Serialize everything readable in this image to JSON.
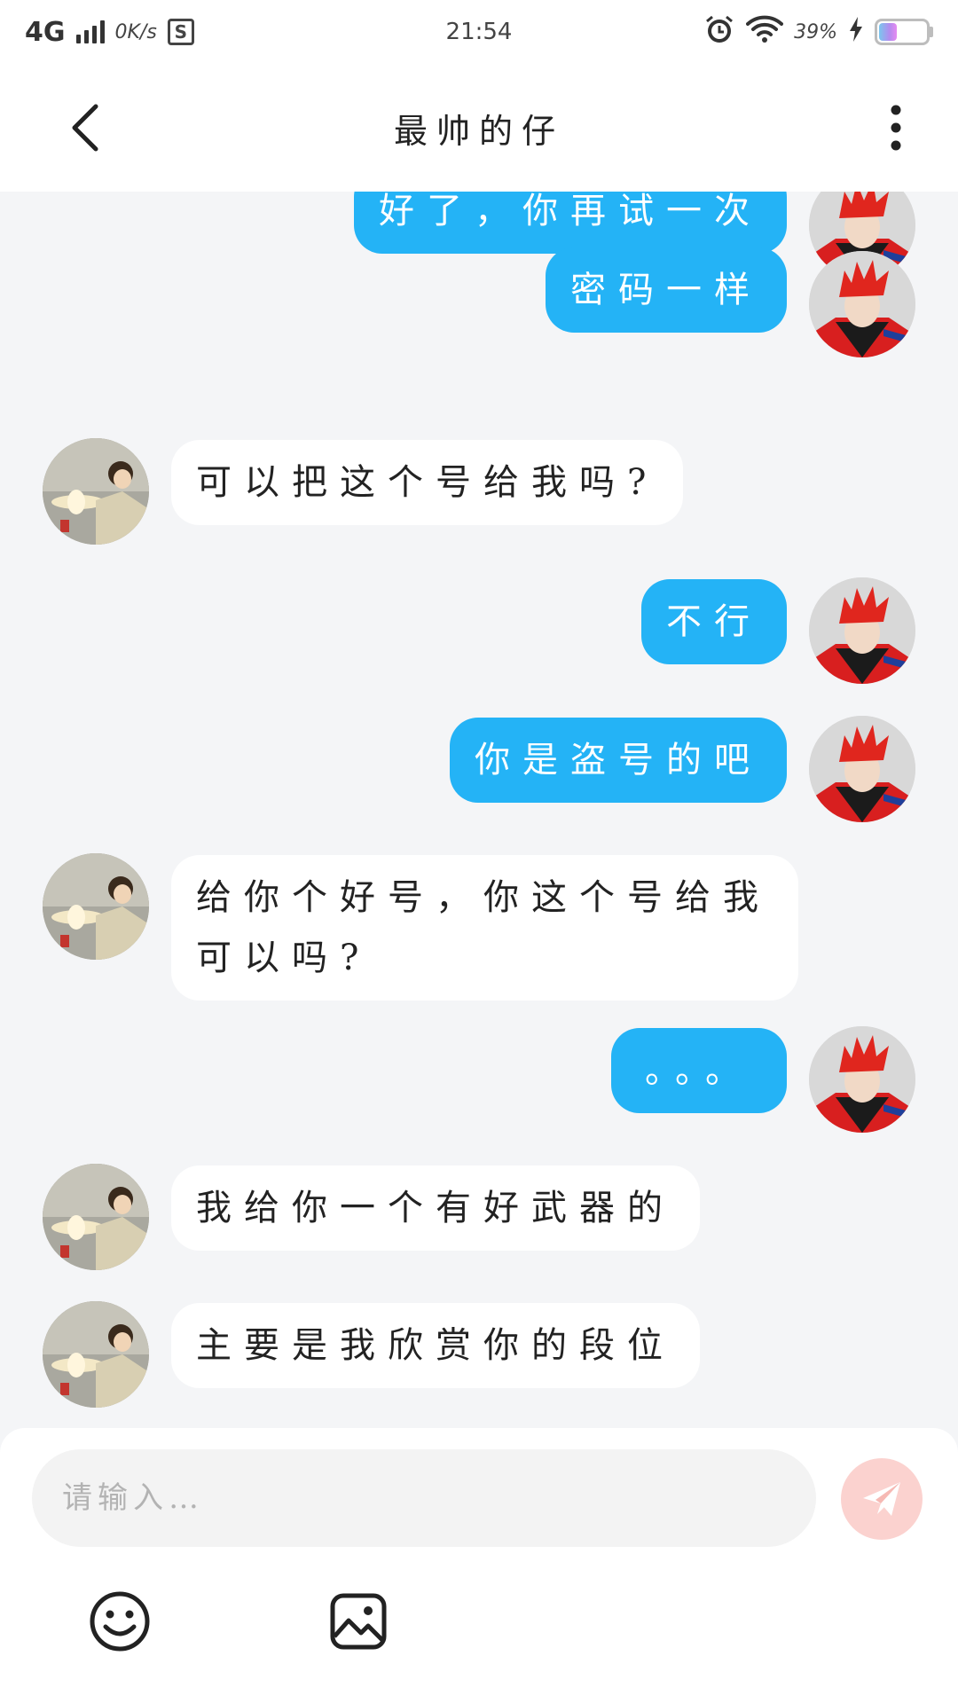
{
  "status_bar": {
    "network": "4G",
    "speed": "0K/s",
    "s_badge": "S",
    "time": "21:54",
    "battery": "39%",
    "battery_level": 0.39
  },
  "header": {
    "title": "最帅的仔",
    "back_icon": "chevron-left-icon",
    "more_icon": "more-vertical-icon"
  },
  "messages": [
    {
      "side": "self",
      "text": "好了，你再试一次"
    },
    {
      "side": "self",
      "text": "密码一样"
    },
    {
      "side": "other",
      "text": "可以把这个号给我吗?"
    },
    {
      "side": "self",
      "text": "不行"
    },
    {
      "side": "self",
      "text": "你是盗号的吧"
    },
    {
      "side": "other",
      "text": "给你个好号，你这个号给我可以吗?"
    },
    {
      "side": "self",
      "text": "。。。"
    },
    {
      "side": "other",
      "text": "我给你一个有好武器的"
    },
    {
      "side": "other",
      "text": "主要是我欣赏你的段位"
    }
  ],
  "input": {
    "placeholder": "请输入…",
    "value": ""
  },
  "icons": {
    "send": "send-icon",
    "emoji": "emoji-icon",
    "image": "image-icon"
  },
  "colors": {
    "self_bubble": "#24b3f6",
    "other_bubble": "#ffffff",
    "background": "#f4f5f7",
    "send_button": "#fbd2cf"
  }
}
